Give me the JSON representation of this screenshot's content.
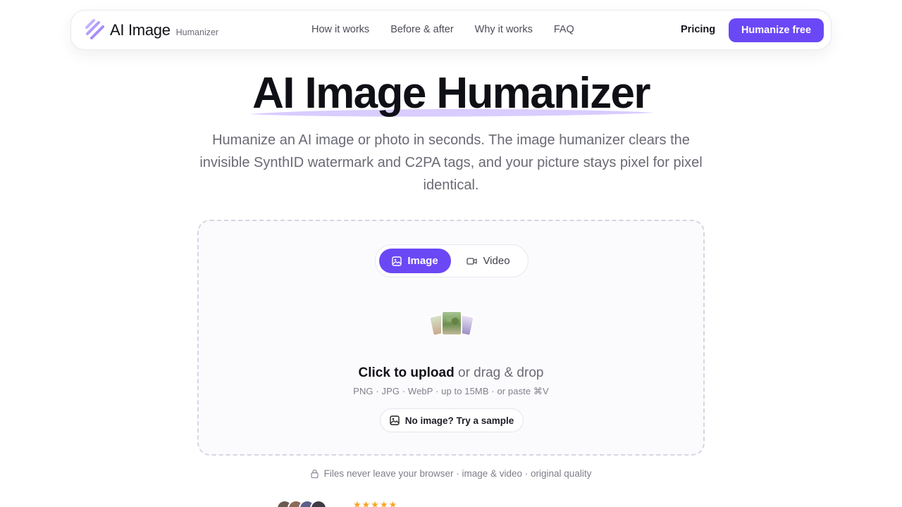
{
  "nav": {
    "brand_name": "AI Image",
    "brand_sub": "Humanizer",
    "links": [
      "How it works",
      "Before & after",
      "Why it works",
      "FAQ"
    ],
    "pricing": "Pricing",
    "cta": "Humanize free"
  },
  "hero": {
    "title": "AI Image Humanizer",
    "description": "Humanize an AI image or photo in seconds. The image humanizer clears the invisible SynthID watermark and C2PA tags, and your picture stays pixel for pixel identical."
  },
  "uploader": {
    "tabs": [
      {
        "label": "Image",
        "icon": "image-icon",
        "active": true
      },
      {
        "label": "Video",
        "icon": "video-icon",
        "active": false
      }
    ],
    "upload_strong": "Click to upload",
    "upload_rest": "or drag & drop",
    "formats": "PNG · JPG · WebP · up to 15MB · or paste ⌘V",
    "sample_button": "No image? Try a sample"
  },
  "privacy_note": "Files never leave your browser · image & video · original quality",
  "rating": {
    "stars": 5,
    "star_glyphs": "★★★★★"
  },
  "colors": {
    "accent": "#6b48f5",
    "underline": "#d9ccff",
    "star": "#f5a524"
  }
}
